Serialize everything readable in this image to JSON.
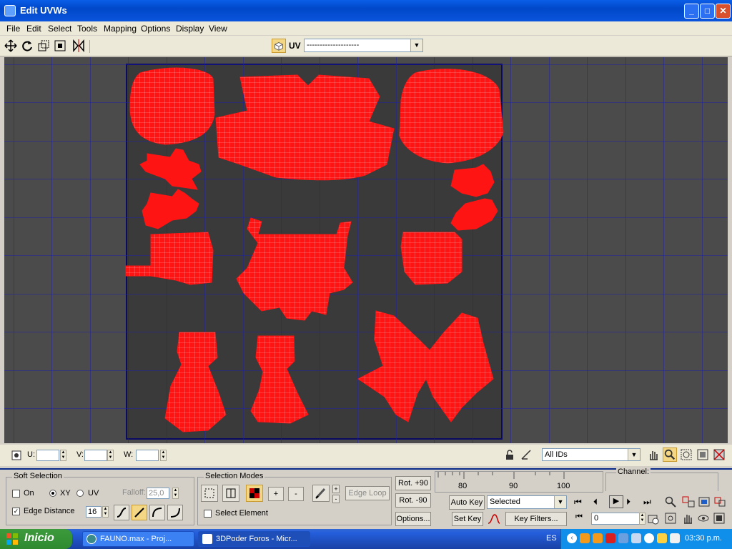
{
  "window": {
    "title": "Edit UVWs",
    "controls": {
      "minimize": "_",
      "maximize": "□",
      "close": "✕"
    }
  },
  "menu": [
    "File",
    "Edit",
    "Select",
    "Tools",
    "Mapping",
    "Options",
    "Display",
    "View"
  ],
  "toolbar": {
    "uv_label": "UV",
    "map_dropdown_value": "--------------------",
    "tools": [
      "move-icon",
      "rotate-icon",
      "scale-icon",
      "freeform-icon",
      "mirror-icon",
      "checker-icon"
    ]
  },
  "coords": {
    "u_label": "U:",
    "v_label": "V:",
    "w_label": "W:",
    "u_value": "",
    "v_value": "",
    "w_value": "",
    "ids_dropdown_value": "All IDs"
  },
  "soft_selection": {
    "title": "Soft Selection",
    "on_label": "On",
    "xy_label": "XY",
    "uv_label": "UV",
    "falloff_label": "Falloff:",
    "falloff_value": "25,0",
    "edge_distance_label": "Edge Distance",
    "edge_distance_value": "16",
    "on_checked": false,
    "edge_distance_checked": true,
    "selected_radio": "XY"
  },
  "selection_modes": {
    "title": "Selection Modes",
    "plus_label": "+",
    "minus_label": "-",
    "edge_loop_label": "Edge Loop",
    "select_element_label": "Select Element"
  },
  "rotate": {
    "rot_plus_label": "Rot. +90",
    "rot_minus_label": "Rot. -90",
    "options_label": "Options..."
  },
  "timeline": {
    "ticks": [
      "80",
      "90",
      "100"
    ]
  },
  "animation": {
    "auto_key_label": "Auto Key",
    "set_key_label": "Set Key",
    "key_mode_value": "Selected",
    "key_filters_label": "Key Filters...",
    "frame_value": "0"
  },
  "channel": {
    "title": "Channel:"
  },
  "taskbar": {
    "start_label": "Inicio",
    "tasks": [
      "FAUNO.max       - Proj...",
      "3DPoder Foros - Micr..."
    ],
    "language": "ES",
    "clock": "03:30 p.m."
  },
  "colors": {
    "uv_mesh": "#ff1414",
    "grid": "#1919b4",
    "viewport_bg": "#4b4b4b",
    "xp_blue": "#0a5ee8"
  }
}
